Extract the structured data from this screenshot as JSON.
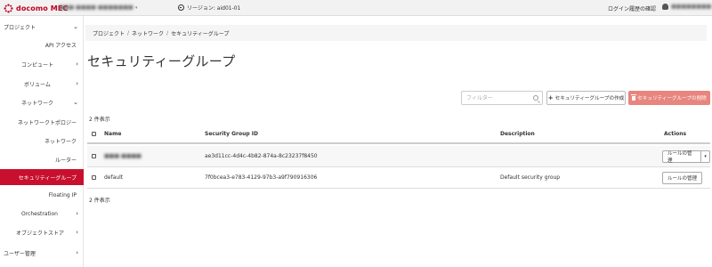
{
  "topbar": {
    "brand": "docomo MEC",
    "project_selector": "■■■-■■■■-■■■■■■■",
    "region": "リージョン: aid01-01",
    "login_history": "ログイン履歴の確認",
    "user_name": "■■■■■■■■"
  },
  "sidebar": {
    "items": [
      {
        "label": "プロジェクト",
        "chevron": "⌄"
      },
      {
        "label": "API アクセス",
        "chevron": ""
      },
      {
        "label": "コンピュート",
        "chevron": "›"
      },
      {
        "label": "ボリューム",
        "chevron": "›"
      },
      {
        "label": "ネットワーク",
        "chevron": "⌄"
      },
      {
        "label": "ネットワークトポロジー",
        "chevron": ""
      },
      {
        "label": "ネットワーク",
        "chevron": ""
      },
      {
        "label": "ルーター",
        "chevron": ""
      },
      {
        "label": "セキュリティーグループ",
        "chevron": ""
      },
      {
        "label": "Floating IP",
        "chevron": ""
      },
      {
        "label": "Orchestration",
        "chevron": "›"
      },
      {
        "label": "オブジェクトストア",
        "chevron": "›"
      },
      {
        "label": "ユーザー管理",
        "chevron": "›"
      }
    ]
  },
  "breadcrumb": {
    "items": [
      "プロジェクト",
      "ネットワーク",
      "セキュリティーグループ"
    ],
    "separator": "/"
  },
  "page_title": "セキュリティーグループ",
  "toolbar": {
    "filter_placeholder": "フィルター",
    "create_label": "セキュリティーグループの作成",
    "delete_label": "セキュリティーグループの削除"
  },
  "count_label": "2 件表示",
  "table": {
    "headers": {
      "name": "Name",
      "id": "Security Group ID",
      "description": "Description",
      "actions": "Actions"
    },
    "rows": [
      {
        "name": "■■■-■■■■",
        "id": "ae3d11cc-4d4c-4b82-874a-8c23237f8450",
        "description": "",
        "action": "ルールの管理",
        "has_dropdown": true
      },
      {
        "name": "default",
        "id": "7f0bcea3-e783-4129-97b3-a9f790916306",
        "description": "Default security group",
        "action": "ルールの管理",
        "has_dropdown": false
      }
    ]
  },
  "colors": {
    "brand": "#c00020",
    "active_sidebar": "#c8102e",
    "delete_button": "#e8857f"
  }
}
